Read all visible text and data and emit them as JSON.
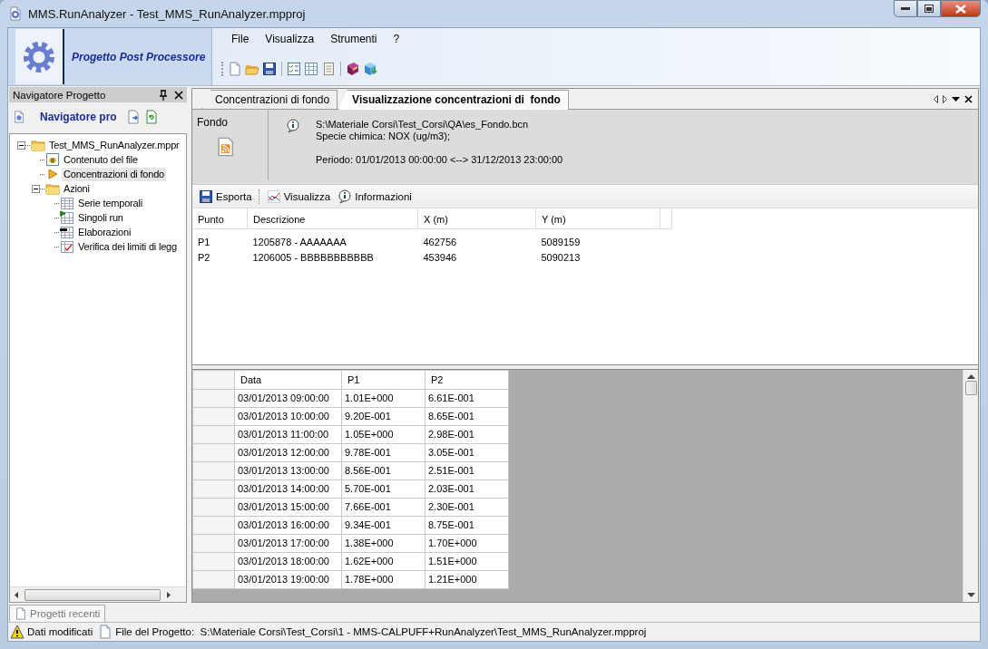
{
  "window": {
    "title": "MMS.RunAnalyzer - Test_MMS_RunAnalyzer.mpproj"
  },
  "header": {
    "title": "Progetto Post Processore"
  },
  "menu": [
    "File",
    "Visualizza",
    "Strumenti",
    "?"
  ],
  "navigator": {
    "title": "Navigatore Progetto",
    "toolbar_label": "Navigatore pro",
    "tree": [
      {
        "kind": "folder",
        "label": "Test_MMS_RunAnalyzer.mppr",
        "expanded": true,
        "selected": false,
        "children": [
          {
            "kind": "file",
            "label": "Contenuto del file",
            "selected": false
          },
          {
            "kind": "background",
            "label": "Concentrazioni di fondo",
            "selected": true
          },
          {
            "kind": "folder",
            "label": "Azioni",
            "expanded": true,
            "selected": false,
            "children": [
              {
                "kind": "series",
                "label": "Serie temporali",
                "selected": false
              },
              {
                "kind": "run",
                "label": "Singoli run",
                "selected": false
              },
              {
                "kind": "elab",
                "label": "Elaborazioni",
                "selected": false
              },
              {
                "kind": "check",
                "label": "Verifica dei limiti di legg",
                "selected": false
              }
            ]
          }
        ]
      }
    ]
  },
  "document": {
    "tabs": [
      {
        "label": "Concentrazioni di fondo",
        "selected": false
      },
      {
        "label": "Visualizzazione concentrazioni di  fondo",
        "selected": true
      }
    ],
    "info": {
      "section": "Fondo",
      "file": "S:\\Materiale Corsi\\Test_Corsi\\QA\\es_Fondo.bcn",
      "species": "Specie chimica: NOX (ug/m3);",
      "period": "Periodo: 01/01/2013 00:00:00 <--> 31/12/2013 23:00:00"
    },
    "toolbar": [
      {
        "kind": "export",
        "label": "Esporta"
      },
      {
        "kind": "chart",
        "label": "Visualizza"
      },
      {
        "kind": "info",
        "label": "Informazioni"
      }
    ],
    "points": {
      "columns": [
        "Punto",
        "Descrizione",
        "X (m)",
        "Y (m)"
      ],
      "rows": [
        [
          "P1",
          "1205878 - AAAAAAA",
          "462756",
          "5089159"
        ],
        [
          "P2",
          "1206005 - BBBBBBBBBBB",
          "453946",
          "5090213"
        ]
      ]
    },
    "grid": {
      "columns": [
        "Data",
        "P1",
        "P2"
      ],
      "rows": [
        [
          "03/01/2013 09:00:00",
          "1.01E+000",
          "6.61E-001"
        ],
        [
          "03/01/2013 10:00:00",
          "9.20E-001",
          "8.65E-001"
        ],
        [
          "03/01/2013 11:00:00",
          "1.05E+000",
          "2.98E-001"
        ],
        [
          "03/01/2013 12:00:00",
          "9.78E-001",
          "3.05E-001"
        ],
        [
          "03/01/2013 13:00:00",
          "8.56E-001",
          "2.51E-001"
        ],
        [
          "03/01/2013 14:00:00",
          "5.70E-001",
          "2.03E-001"
        ],
        [
          "03/01/2013 15:00:00",
          "7.66E-001",
          "2.30E-001"
        ],
        [
          "03/01/2013 16:00:00",
          "9.34E-001",
          "8.75E-001"
        ],
        [
          "03/01/2013 17:00:00",
          "1.38E+000",
          "1.70E+000"
        ],
        [
          "03/01/2013 18:00:00",
          "1.62E+000",
          "1.51E+000"
        ],
        [
          "03/01/2013 19:00:00",
          "1.78E+000",
          "1.21E+000"
        ]
      ]
    }
  },
  "recent_tab": "Progetti recenti",
  "status_bar": [
    {
      "kind": "warning",
      "text": "Dati modificati"
    },
    {
      "kind": "file",
      "text": "File del Progetto:  S:\\Materiale Corsi\\Test_Corsi\\1 - MMS-CALPUFF+RunAnalyzer\\Test_MMS_RunAnalyzer.mpproj"
    }
  ]
}
